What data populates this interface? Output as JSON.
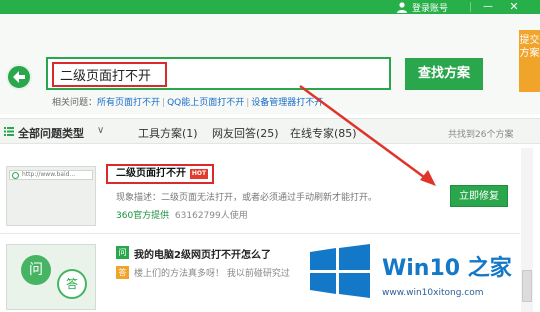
{
  "header": {
    "user_label": "登录账号",
    "minimize": "—",
    "close": "✕"
  },
  "search": {
    "query": "二级页面打不开",
    "button_label": "查找方案",
    "feedback_label": "提交方案",
    "related_label": "相关问题：",
    "related_links": [
      "所有页面打不开",
      "QQ能上页面打不开",
      "设备管理器打不开"
    ]
  },
  "filters": {
    "all_label": "全部问题类型",
    "tabs": [
      "工具方案(1)",
      "网友回答(25)",
      "在线专家(85)"
    ],
    "found": "共找到26个方案"
  },
  "results": [
    {
      "title": "二级页面打不开",
      "badge": "HOT",
      "thumb_url": "http://www.baid...",
      "desc": "现象描述：二级页面无法打开，或者必须通过手动刷新才能打开。",
      "source": "360官方提供",
      "users": "63162799人使用",
      "action": "立即修复"
    },
    {
      "q_icon": "问",
      "a_icon": "答",
      "title": "我的电脑2级网页打不开怎么了",
      "answer": "楼上们的方法真多呀！ 我以前碰研究过",
      "bubble_q": "问",
      "bubble_a": "答"
    }
  ],
  "watermark": {
    "title": "Win10 之家",
    "url": "www.win10xitong.com"
  },
  "colors": {
    "brand_green": "#2aa64c",
    "highlight_red": "#d92b2b",
    "link_blue": "#1a6dc8",
    "feedback_orange": "#f0a42a"
  }
}
